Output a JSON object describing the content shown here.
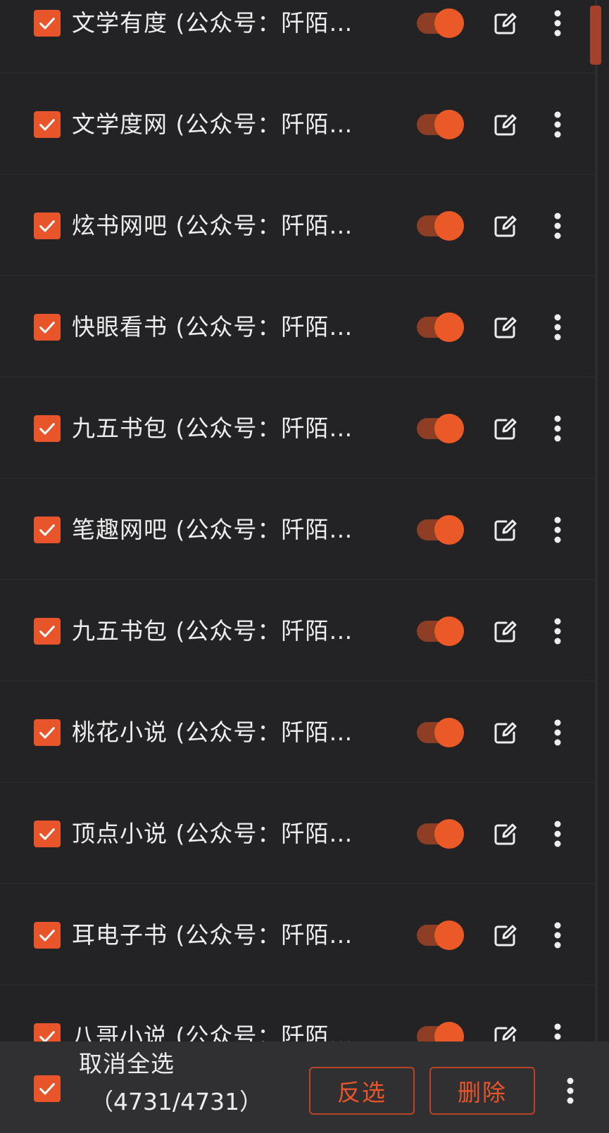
{
  "colors": {
    "accent": "#e8552a",
    "background": "#232325",
    "bottom_bar": "#303033",
    "text": "#ededed"
  },
  "icons": {
    "checkbox": "check-icon",
    "toggle": "toggle-on-icon",
    "edit": "edit-icon",
    "more": "more-vertical-icon"
  },
  "sources": [
    {
      "name": "文学有度 (公众号：阡陌…",
      "checked": true,
      "enabled": true
    },
    {
      "name": "文学度网 (公众号：阡陌…",
      "checked": true,
      "enabled": true
    },
    {
      "name": "炫书网吧 (公众号：阡陌…",
      "checked": true,
      "enabled": true
    },
    {
      "name": "快眼看书 (公众号：阡陌…",
      "checked": true,
      "enabled": true
    },
    {
      "name": "九五书包 (公众号：阡陌…",
      "checked": true,
      "enabled": true
    },
    {
      "name": "笔趣网吧 (公众号：阡陌…",
      "checked": true,
      "enabled": true
    },
    {
      "name": "九五书包 (公众号：阡陌…",
      "checked": true,
      "enabled": true
    },
    {
      "name": "桃花小说 (公众号：阡陌…",
      "checked": true,
      "enabled": true
    },
    {
      "name": "顶点小说 (公众号：阡陌…",
      "checked": true,
      "enabled": true
    },
    {
      "name": "耳电子书 (公众号：阡陌…",
      "checked": true,
      "enabled": true
    },
    {
      "name": "八哥小说 (公众号：阡陌…",
      "checked": true,
      "enabled": true
    }
  ],
  "bottom_bar": {
    "select_all_label": "取消全选",
    "selection_count": "（4731/4731）",
    "invert_label": "反选",
    "delete_label": "删除"
  }
}
